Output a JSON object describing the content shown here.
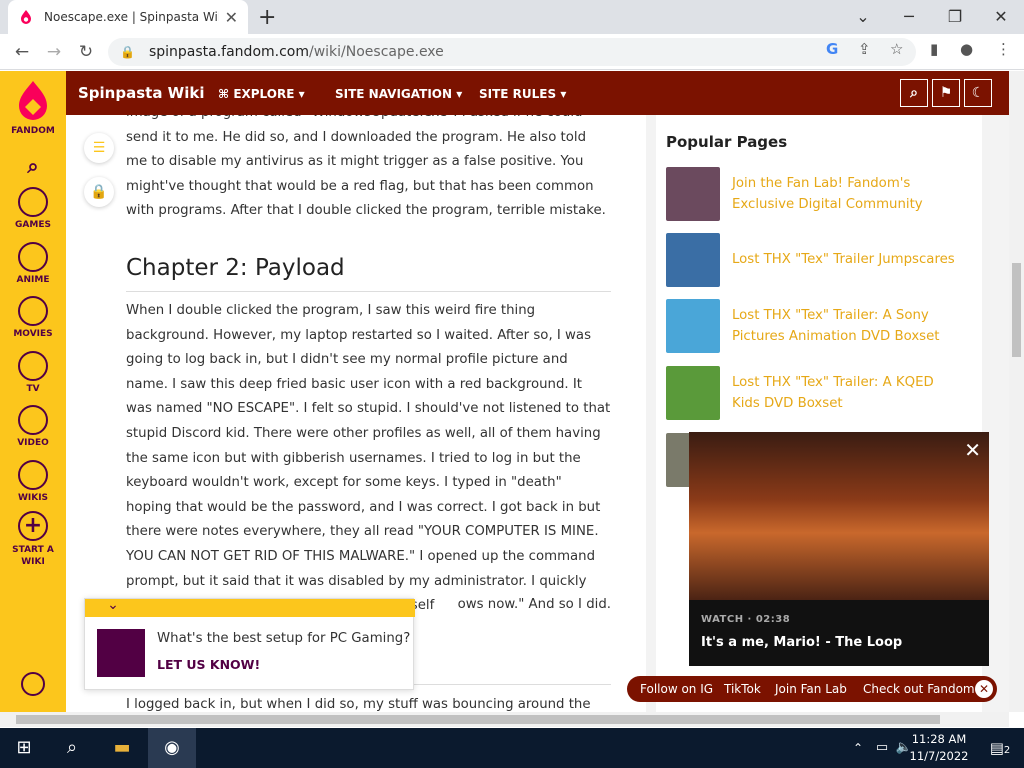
{
  "browser": {
    "tab_title": "Noescape.exe | Spinpasta Wiki | F",
    "url_host": "spinpasta.fandom.com",
    "url_path": "/wiki/Noescape.exe"
  },
  "rail": {
    "logo_label": "FANDOM",
    "items": [
      {
        "label": "GAMES"
      },
      {
        "label": "ANIME"
      },
      {
        "label": "MOVIES"
      },
      {
        "label": "TV"
      },
      {
        "label": "VIDEO"
      },
      {
        "label": "WIKIS"
      },
      {
        "label": "START A WIKI"
      }
    ]
  },
  "wiki_header": {
    "name": "Spinpasta Wiki",
    "nav": [
      "EXPLORE",
      "SITE NAVIGATION",
      "SITE RULES"
    ]
  },
  "article": {
    "para1": "image of a program called \"WindowsUpdate.exe\". I asked if he could send it to me. He did so, and I downloaded the program. He also told me to disable my antivirus as it might trigger as a false positive. You might've thought that would be a red flag, but that has been common with programs. After that I double clicked the program, terrible mistake.",
    "chapter_title": "Chapter 2: Payload",
    "para2": "When I double clicked the program, I saw this weird fire thing background. However, my laptop restarted so I waited. After so, I was going to log back in, but I didn't see my normal profile picture and name. I saw this deep fried basic user icon with a red background. It was named \"NO ESCAPE\". I felt so stupid. I should've not listened to that stupid Discord kid. There were other profiles as well, all of them having the same icon but with gibberish usernames. I tried to log in but the keyboard wouldn't work, except for some keys. I typed in \"death\" hoping that would be the password, and I was correct. I got back in but there were notes everywhere, they all read \"YOUR COMPUTER IS MINE. YOU CAN NOT GET RID OF THIS MALWARE.\" I opened up the command prompt, but it said that it was disabled by my administrator. I quickly deleted the random notes. I thought to myself",
    "para2_tail": "ows now.\" And so I did.",
    "para3": "I logged back in, but when I did so, my stuff was bouncing around the"
  },
  "sidebar": {
    "heading": "Popular Pages",
    "pages": [
      {
        "title": "Join the Fan Lab! Fandom's Exclusive Digital Community",
        "color": "#6b4a5e"
      },
      {
        "title": "Lost THX \"Tex\" Trailer Jumpscares",
        "color": "#3a6ea5"
      },
      {
        "title": "Lost THX \"Tex\" Trailer: A Sony Pictures Animation DVD Boxset",
        "color": "#4aa6d8"
      },
      {
        "title": "Lost THX \"Tex\" Trailer: A KQED Kids DVD Boxset",
        "color": "#5a9a3a"
      }
    ]
  },
  "video": {
    "meta": "WATCH · 02:38",
    "title": "It's a me, Mario! - The Loop"
  },
  "poll": {
    "question": "What's the best setup for PC Gaming?",
    "cta": "LET US KNOW!"
  },
  "social": {
    "links": [
      "Follow on IG",
      "TikTok",
      "Join Fan Lab",
      "Check out Fandom"
    ]
  },
  "taskbar": {
    "time": "11:28 AM",
    "date": "11/7/2022",
    "notif_count": "2"
  },
  "colors": {
    "fandom_yellow": "#fcc61c",
    "fandom_purple": "#520044",
    "wiki_red": "#7b1200",
    "link_gold": "#e6a817"
  }
}
